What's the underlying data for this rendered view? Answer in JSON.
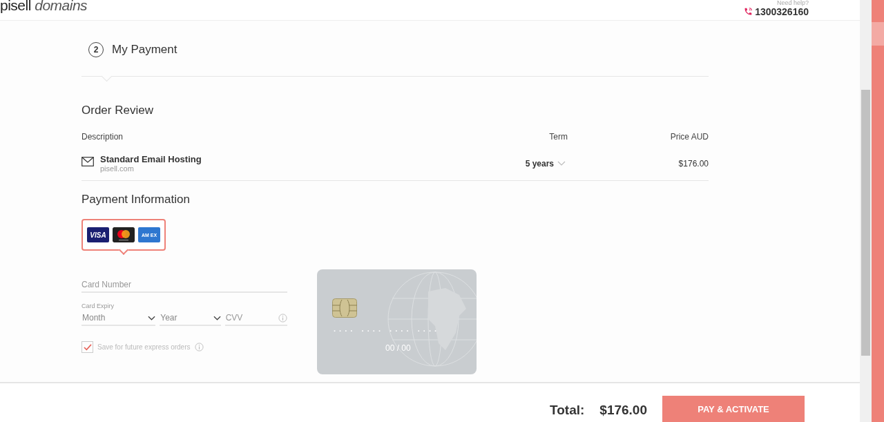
{
  "header": {
    "logo_brand": "pisell",
    "logo_suffix": "domains",
    "help_label": "Need help?",
    "phone": "1300326160"
  },
  "step": {
    "number": "2",
    "title": "My Payment"
  },
  "order_review": {
    "title": "Order Review",
    "columns": [
      "Description",
      "Term",
      "Price AUD"
    ],
    "rows": [
      {
        "name": "Standard Email Hosting",
        "domain": "pisell.com",
        "term": "5 years",
        "price": "$176.00"
      }
    ]
  },
  "payment": {
    "title": "Payment Information",
    "card_brands": [
      {
        "kind": "visa",
        "label": "VISA",
        "selected": true
      },
      {
        "kind": "mastercard",
        "selected": true
      },
      {
        "kind": "amex",
        "label": "AM EX",
        "selected": true
      }
    ],
    "card_number": {
      "placeholder": "Card Number"
    },
    "expiry_label": "Card Expiry",
    "month": {
      "placeholder": "Month"
    },
    "year": {
      "placeholder": "Year"
    },
    "cvv": {
      "placeholder": "CVV"
    },
    "save": {
      "label": "Save for future express orders",
      "checked": true
    },
    "card_preview": {
      "number_mask": ". . . .   . . . .   . . . .   . . . .",
      "expiry": "00 / 00"
    }
  },
  "footer": {
    "total_label": "Total:",
    "total": "$176.00",
    "button": "PAY & ACTIVATE"
  }
}
